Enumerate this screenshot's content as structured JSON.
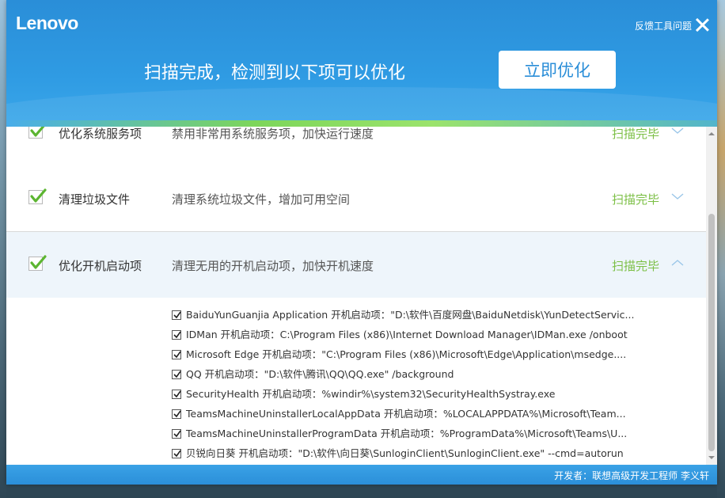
{
  "header": {
    "logo": "Lenovo",
    "feedback": "反馈工具问题",
    "scan_message": "扫描完成，检测到以下项可以优化",
    "optimize_button": "立即优化"
  },
  "rows": [
    {
      "title": "优化系统服务项",
      "desc": "禁用非常用系统服务项，加快运行速度",
      "status": "扫描完毕",
      "expanded": false
    },
    {
      "title": "清理垃圾文件",
      "desc": "清理系统垃圾文件，增加可用空间",
      "status": "扫描完毕",
      "expanded": false
    },
    {
      "title": "优化开机启动项",
      "desc": "清理无用的开机启动项，加快开机速度",
      "status": "扫描完毕",
      "expanded": true
    }
  ],
  "startup_items": [
    "BaiduYunGuanjia Application 开机启动项：\"D:\\软件\\百度网盘\\BaiduNetdisk\\YunDetectServic...",
    "IDMan 开机启动项：C:\\Program Files (x86)\\Internet Download Manager\\IDMan.exe /onboot",
    "Microsoft Edge 开机启动项：\"C:\\Program Files (x86)\\Microsoft\\Edge\\Application\\msedge....",
    "QQ 开机启动项：\"D:\\软件\\腾讯\\QQ\\QQ.exe\" /background",
    "SecurityHealth 开机启动项：%windir%\\system32\\SecurityHealthSystray.exe",
    "TeamsMachineUninstallerLocalAppData 开机启动项：%LOCALAPPDATA%\\Microsoft\\Team...",
    "TeamsMachineUninstallerProgramData 开机启动项：%ProgramData%\\Microsoft\\Teams\\U...",
    "贝锐向日葵 开机启动项：\"D:\\软件\\向日葵\\SunloginClient\\SunloginClient.exe\" --cmd=autorun"
  ],
  "footer": {
    "developer": "开发者：联想高级开发工程师 李义轩"
  },
  "colors": {
    "header_blue": "#2a8ed8",
    "status_green": "#7bbf44",
    "check_green": "#5cb531"
  }
}
